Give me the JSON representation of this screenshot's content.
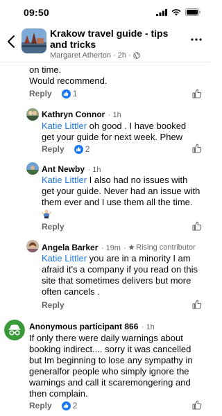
{
  "status": {
    "time": "09:50"
  },
  "header": {
    "title": "Krakow travel guide - tips and tricks",
    "author": "Margaret Atherton",
    "age": "2h"
  },
  "comments": [
    {
      "lines": [
        "on time.",
        "Would recommend."
      ],
      "reply": "Reply",
      "likes": "1"
    },
    {
      "name": "Kathryn Connor",
      "time": "1h",
      "mention": "Katie Littler",
      "text_first": " oh good . I have booked",
      "text_rest": [
        "get your guide for next week. Phew"
      ],
      "reply": "Reply",
      "likes": "2"
    },
    {
      "name": "Ant Newby",
      "time": "1h",
      "mention": "Katie Littler",
      "text_first": " I also had no issues with",
      "text_rest": [
        "get your guide. Never had an issue with",
        "them ever and I use them all the time."
      ],
      "reply": "Reply"
    },
    {
      "name": "Angela Barker",
      "time": "19m",
      "badge": "Rising contributor",
      "mention": "Katie Littler",
      "text_first": " you are in a minority I am",
      "text_rest": [
        "afraid it's a company if you read on this",
        "site that sometimes delivers but more",
        "often cancels ."
      ],
      "reply": "Reply"
    },
    {
      "name": "Anonymous participant 866",
      "time": "1h",
      "text_rest": [
        "If only there were daily warnings about",
        "booking indirect.... sorry it was cancelled",
        "but Im beginning to lose any sympathy in",
        "generalfor people who simply ignore the",
        "warnings and call it scaremongering and",
        "then complain."
      ],
      "reply": "Reply",
      "likes": "2"
    }
  ],
  "colors": {
    "accent": "#1877f2",
    "mention": "#1b74e4",
    "secondary_text": "#65676b",
    "anon_avatar": "#3a9a3a"
  },
  "icons": [
    "back-icon",
    "more-icon",
    "like-icon",
    "thumbs-up-icon",
    "globe-icon",
    "star-icon",
    "incognito-icon"
  ]
}
